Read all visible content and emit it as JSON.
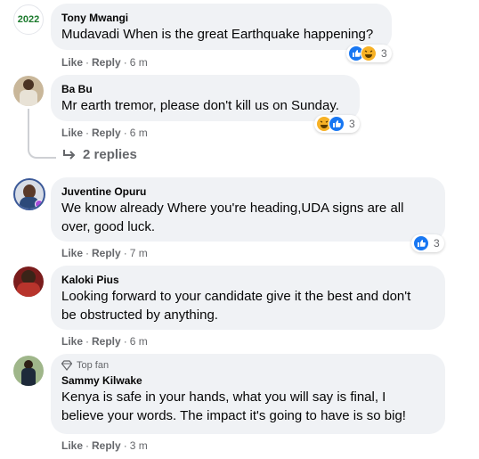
{
  "actions": {
    "like": "Like",
    "reply": "Reply",
    "separator": "·"
  },
  "comments": [
    {
      "name": "Tony Mwangi",
      "avatar_text": "2022",
      "text_lines": [
        "Mudavadi When is the great Earthquake happening?"
      ],
      "time": "6 m",
      "reactions": {
        "icons": [
          "like-icon",
          "haha-icon"
        ],
        "count": "3"
      }
    },
    {
      "name": "Ba Bu",
      "text_lines": [
        "Mr earth tremor, please don't kill us on Sunday."
      ],
      "time": "6 m",
      "reactions": {
        "icons": [
          "haha-icon",
          "like-icon"
        ],
        "count": "3"
      },
      "replies_label": "2 replies"
    },
    {
      "name": "Juventine Opuru",
      "text_lines": [
        "We know already Where you're heading,UDA signs are all",
        "over, good luck."
      ],
      "time": "7 m",
      "reactions": {
        "icons": [
          "like-icon"
        ],
        "count": "3"
      }
    },
    {
      "name": "Kaloki Pius",
      "text_lines": [
        "Looking forward to your candidate give it the best and don't",
        "be obstructed by anything."
      ],
      "time": "6 m"
    },
    {
      "name": "Sammy Kilwake",
      "badge": "Top fan",
      "text_lines": [
        "Kenya is safe in your hands, what you will say is final, I",
        "believe your words. The impact it's going to have is so big!"
      ],
      "time": "3 m"
    }
  ],
  "colors": {
    "bubble": "#f0f2f5",
    "secondary_text": "#65676b",
    "like_blue": "#1877f2",
    "haha_yellow": "#f7b125"
  }
}
